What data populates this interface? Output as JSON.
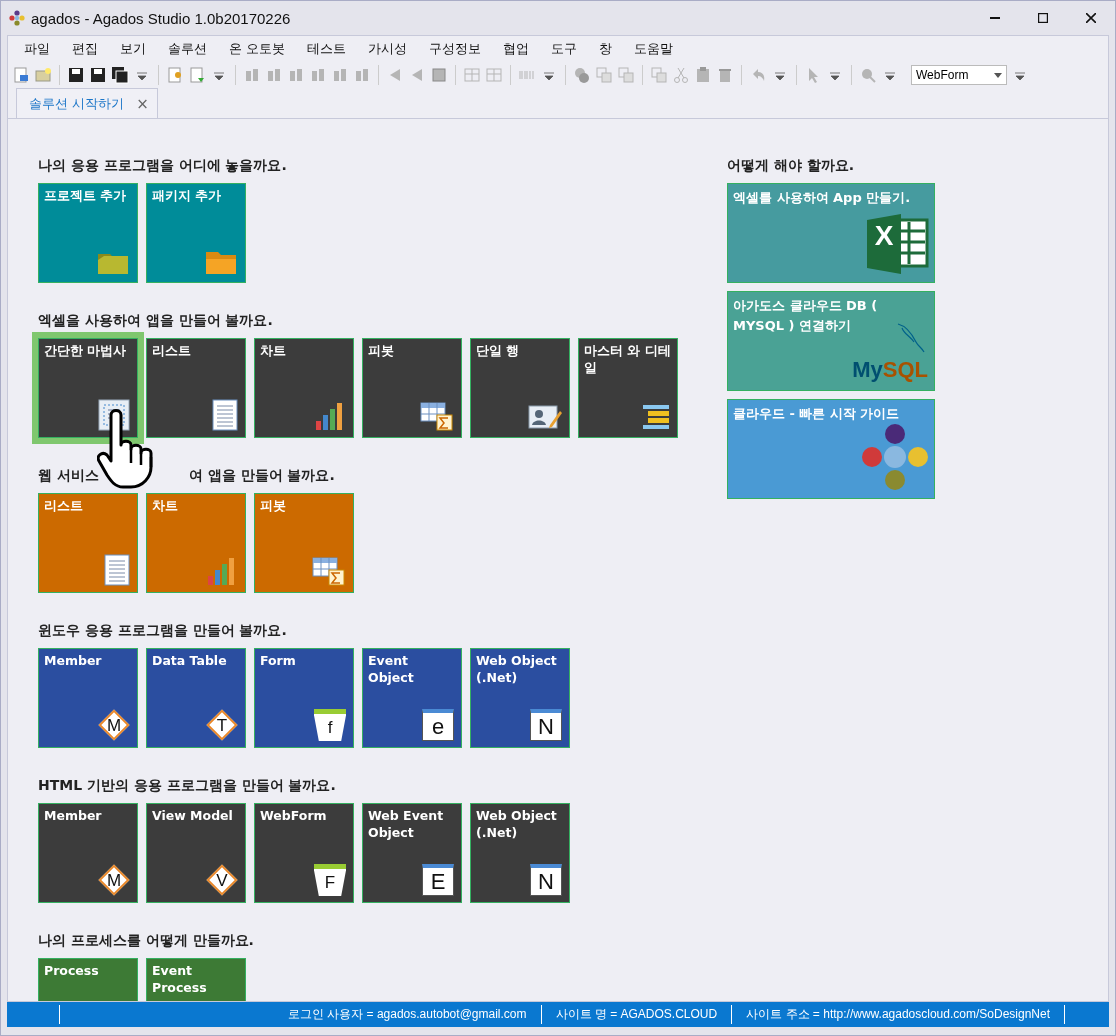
{
  "window": {
    "title": "agados - Agados Studio 1.0b20170226"
  },
  "menu": [
    "파일",
    "편집",
    "보기",
    "솔루션",
    "온 오토봇",
    "테스트",
    "가시성",
    "구성정보",
    "협업",
    "도구",
    "창",
    "도움말"
  ],
  "toolbar": {
    "combo": "WebForm"
  },
  "tabs": [
    {
      "label": "솔루션 시작하기",
      "selected": true,
      "close": "×"
    }
  ],
  "sections": [
    {
      "title": "나의 응용 프로그램을 어디에 놓을까요.",
      "color": "#008c99",
      "tiles": [
        {
          "label": "프로젝트 추가",
          "kind": "folder-green",
          "selected": false
        },
        {
          "label": "패키지 추가",
          "kind": "folder-orange",
          "selected": false
        }
      ]
    },
    {
      "title": "엑셀을 사용하여 앱을 만들어 볼까요.",
      "color": "#3c3c3c",
      "tiles": [
        {
          "label": "간단한 마법사",
          "kind": "wizard",
          "selected": true
        },
        {
          "label": "리스트",
          "kind": "list",
          "selected": false
        },
        {
          "label": "차트",
          "kind": "chart",
          "selected": false
        },
        {
          "label": "피봇",
          "kind": "pivot",
          "selected": false
        },
        {
          "label": "단일 행",
          "kind": "single",
          "selected": false
        },
        {
          "label": "마스터 와 디테일",
          "kind": "master",
          "selected": false
        }
      ]
    },
    {
      "title": "웹 서비스",
      "title_after": "여 앱을 만들어 볼까요.",
      "color": "#cc6a00",
      "tiles": [
        {
          "label": "리스트",
          "kind": "list",
          "selected": false
        },
        {
          "label": "차트",
          "kind": "chart",
          "selected": false
        },
        {
          "label": "피봇",
          "kind": "pivot",
          "selected": false
        }
      ]
    },
    {
      "title": "윈도우 응용 프로그램을 만들어 볼까요.",
      "color": "#2b4ea0",
      "tiles": [
        {
          "label": "Member",
          "kind": "diamond",
          "badge": "M",
          "selected": false
        },
        {
          "label": "Data Table",
          "kind": "diamond",
          "badge": "T",
          "selected": false
        },
        {
          "label": "Form",
          "kind": "pentagon",
          "badge": "f",
          "selected": false
        },
        {
          "label": "Event Object",
          "kind": "doc",
          "badge": "e",
          "selected": false
        },
        {
          "label": "Web Object (.Net)",
          "kind": "doc",
          "badge": "N",
          "selected": false
        }
      ]
    },
    {
      "title": "HTML 기반의 응용 프로그램을 만들어 볼까요.",
      "color": "#3c3c3c",
      "tiles": [
        {
          "label": "Member",
          "kind": "diamond",
          "badge": "M",
          "selected": false
        },
        {
          "label": "View Model",
          "kind": "diamond",
          "badge": "V",
          "selected": false
        },
        {
          "label": "WebForm",
          "kind": "pentagon",
          "badge": "F",
          "selected": false
        },
        {
          "label": "Web Event Object",
          "kind": "doc",
          "badge": "E",
          "selected": false
        },
        {
          "label": "Web Object (.Net)",
          "kind": "doc",
          "badge": "N",
          "selected": false
        }
      ]
    },
    {
      "title": "나의 프로세스를 어떻게 만들까요.",
      "color": "#3d7a35",
      "tiles": [
        {
          "label": "Process",
          "kind": "none",
          "selected": false
        },
        {
          "label": "Event Process",
          "kind": "none",
          "selected": false
        }
      ]
    }
  ],
  "help": {
    "title": "어떻게 해야 할까요.",
    "tiles": [
      {
        "label": "엑셀를 사용하여 App 만들기.",
        "kind": "excel",
        "color": "#469b9f",
        "logo": [
          "X"
        ]
      },
      {
        "label": "아가도스 클라우드 DB ( MYSQL ) 연결하기",
        "kind": "mysql",
        "color": "#4aa295",
        "logo": [
          "My",
          "SQL"
        ]
      },
      {
        "label": "클라우드 - 빠른 시작 가이드",
        "kind": "cloud",
        "color": "#4a9ad4"
      }
    ]
  },
  "status_bar": [
    "로그인 사용자 = agados.autobot@gmail.com",
    "사이트 명 = AGADOS.CLOUD",
    "사이트 주소 = http://www.agadoscloud.com/SoDesignNet"
  ]
}
